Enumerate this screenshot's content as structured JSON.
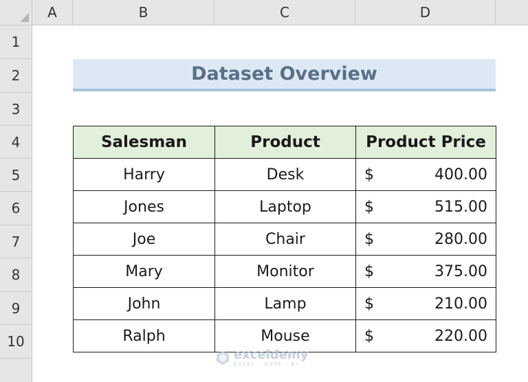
{
  "columns": [
    "A",
    "B",
    "C",
    "D"
  ],
  "rows": [
    "1",
    "2",
    "3",
    "4",
    "5",
    "6",
    "7",
    "8",
    "9",
    "10"
  ],
  "title": "Dataset Overview",
  "table": {
    "headers": [
      "Salesman",
      "Product",
      "Product Price"
    ],
    "rows": [
      {
        "salesman": "Harry",
        "product": "Desk",
        "currency": "$",
        "price": "400.00"
      },
      {
        "salesman": "Jones",
        "product": "Laptop",
        "currency": "$",
        "price": "515.00"
      },
      {
        "salesman": "Joe",
        "product": "Chair",
        "currency": "$",
        "price": "280.00"
      },
      {
        "salesman": "Mary",
        "product": "Monitor",
        "currency": "$",
        "price": "375.00"
      },
      {
        "salesman": "John",
        "product": "Lamp",
        "currency": "$",
        "price": "210.00"
      },
      {
        "salesman": "Ralph",
        "product": "Mouse",
        "currency": "$",
        "price": "220.00"
      }
    ]
  },
  "watermark": {
    "name": "exceldemy",
    "tagline": "EXCEL · DATA · BI"
  },
  "colors": {
    "header_fill": "#e2efda",
    "title_fill": "#dce9f5",
    "title_text": "#5a6f86"
  }
}
